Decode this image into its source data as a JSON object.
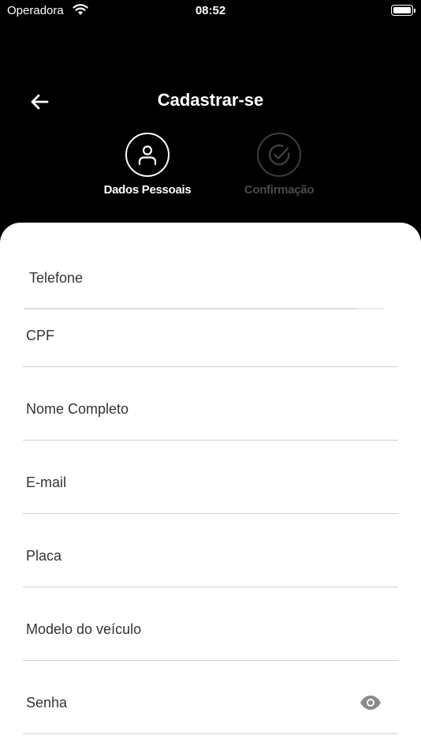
{
  "status_bar": {
    "carrier": "Operadora",
    "time": "08:52"
  },
  "header": {
    "title": "Cadastrar-se"
  },
  "steps": [
    {
      "label": "Dados Pessoais",
      "icon": "person-icon",
      "active": true
    },
    {
      "label": "Confirmação",
      "icon": "check-circle-icon",
      "active": false
    }
  ],
  "form": {
    "fields": [
      {
        "label": "Telefone"
      },
      {
        "label": "CPF"
      },
      {
        "label": "Nome Completo"
      },
      {
        "label": "E-mail"
      },
      {
        "label": "Placa"
      },
      {
        "label": "Modelo do veículo"
      },
      {
        "label": "Senha",
        "toggle_icon": "eye-icon"
      }
    ]
  },
  "colors": {
    "background": "#000000",
    "sheet": "#ffffff",
    "inactive": "#4a4a4a"
  }
}
